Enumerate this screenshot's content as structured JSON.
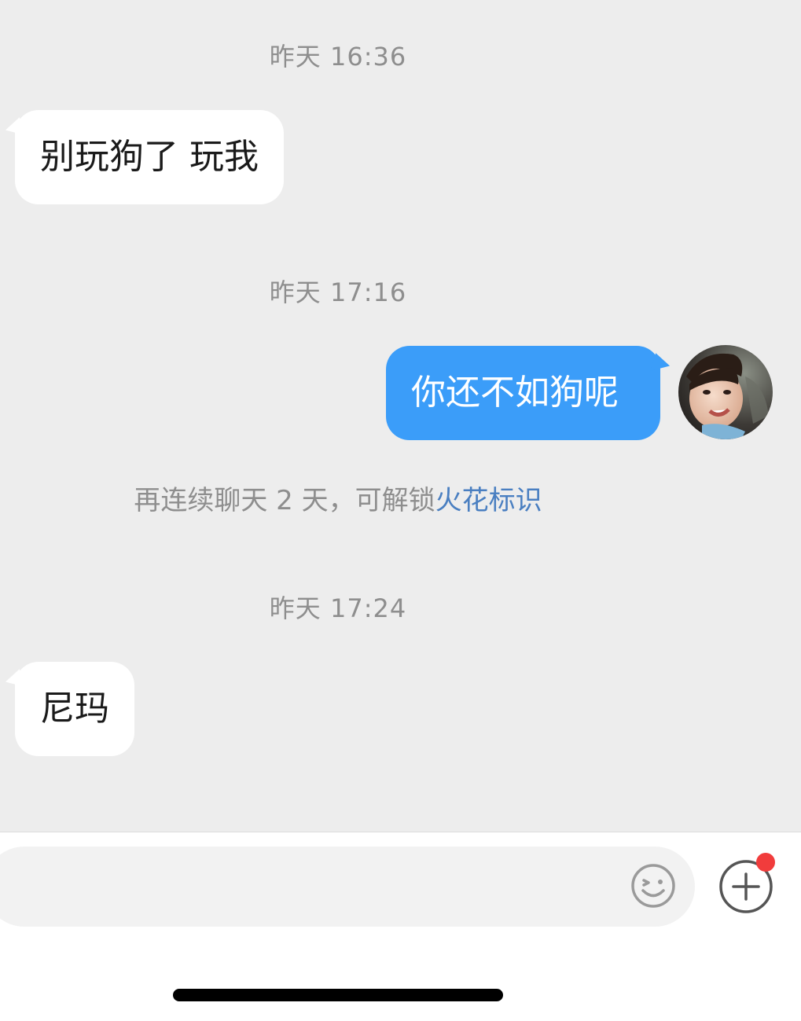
{
  "messages": [
    {
      "timestamp": "昨天 16:36",
      "direction": "incoming",
      "text": "别玩狗了 玩我"
    },
    {
      "timestamp": "昨天 17:16",
      "direction": "outgoing",
      "text": "你还不如狗呢"
    },
    {
      "timestamp": "昨天 17:24",
      "direction": "incoming",
      "text": "尼玛"
    }
  ],
  "system_notice": {
    "text": "再连续聊天 2 天，可解锁",
    "link_text": "火花标识"
  },
  "input": {
    "value": "",
    "emoji_icon": "emoji-smiley-icon",
    "plus_icon": "plus-circle-icon",
    "has_notification_dot": true
  },
  "colors": {
    "background": "#ededed",
    "outgoing_bubble": "#3b9df9",
    "incoming_bubble": "#ffffff",
    "link": "#4a7fc1",
    "notification_dot": "#f13c3c"
  }
}
